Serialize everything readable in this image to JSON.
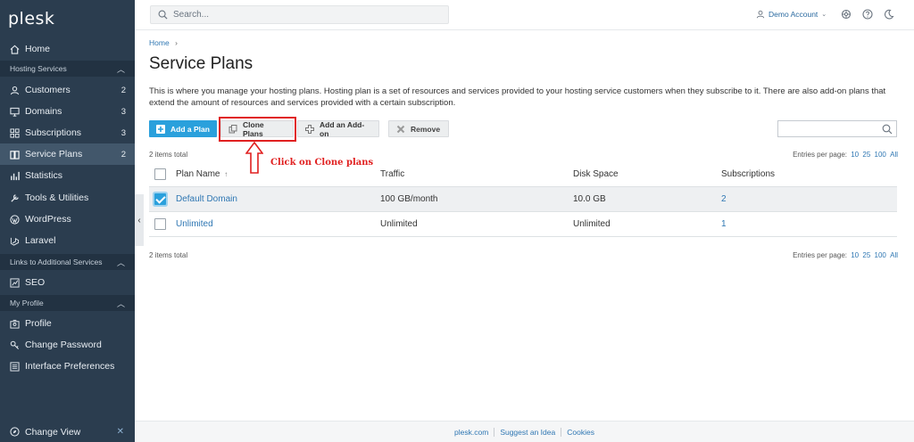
{
  "brand": {
    "logo": "plesk"
  },
  "sidebar": {
    "home": "Home",
    "sections": {
      "hosting": "Hosting Services",
      "links": "Links to Additional Services",
      "profile": "My Profile"
    },
    "hosting_items": [
      {
        "label": "Customers",
        "count": "2",
        "icon": "user-icon"
      },
      {
        "label": "Domains",
        "count": "3",
        "icon": "monitor-icon"
      },
      {
        "label": "Subscriptions",
        "count": "3",
        "icon": "grid-icon"
      },
      {
        "label": "Service Plans",
        "count": "2",
        "icon": "book-icon",
        "active": true
      },
      {
        "label": "Statistics",
        "count": "",
        "icon": "bar-chart-icon"
      },
      {
        "label": "Tools & Utilities",
        "count": "",
        "icon": "tools-icon"
      },
      {
        "label": "WordPress",
        "count": "",
        "icon": "wordpress-icon"
      },
      {
        "label": "Laravel",
        "count": "",
        "icon": "laravel-icon"
      }
    ],
    "links_items": [
      {
        "label": "SEO",
        "icon": "seo-icon"
      }
    ],
    "profile_items": [
      {
        "label": "Profile",
        "icon": "profile-icon"
      },
      {
        "label": "Change Password",
        "icon": "key-icon"
      },
      {
        "label": "Interface Preferences",
        "icon": "preferences-icon"
      }
    ],
    "change_view": "Change View"
  },
  "header": {
    "search_placeholder": "Search...",
    "account": "Demo Account"
  },
  "breadcrumb": "Home",
  "page": {
    "title": "Service Plans",
    "description": "This is where you manage your hosting plans. Hosting plan is a set of resources and services provided to your hosting service customers when they subscribe to it. There are also add-on plans that extend the amount of resources and services provided with a certain subscription."
  },
  "toolbar": {
    "add_plan": "Add a Plan",
    "clone_plans": "Clone Plans",
    "add_addon": "Add an Add-on",
    "remove": "Remove"
  },
  "annotation": {
    "text": "Click on Clone plans",
    "color": "#e02020"
  },
  "list": {
    "total": "2 items total",
    "per_page_label": "Entries per page:",
    "per_page_options": [
      "10",
      "25",
      "100",
      "All"
    ],
    "columns": [
      "Plan Name",
      "Traffic",
      "Disk Space",
      "Subscriptions"
    ],
    "sort_indicator": "↑",
    "rows": [
      {
        "name": "Default Domain",
        "traffic": "100 GB/month",
        "disk": "10.0 GB",
        "subscriptions": "2",
        "checked": true
      },
      {
        "name": "Unlimited",
        "traffic": "Unlimited",
        "disk": "Unlimited",
        "subscriptions": "1",
        "checked": false
      }
    ]
  },
  "footer": {
    "links": [
      "plesk.com",
      "Suggest an Idea",
      "Cookies"
    ]
  },
  "colors": {
    "sidebar": "#2b3d4f",
    "accent": "#2aa0dc",
    "link": "#2f77b3"
  }
}
